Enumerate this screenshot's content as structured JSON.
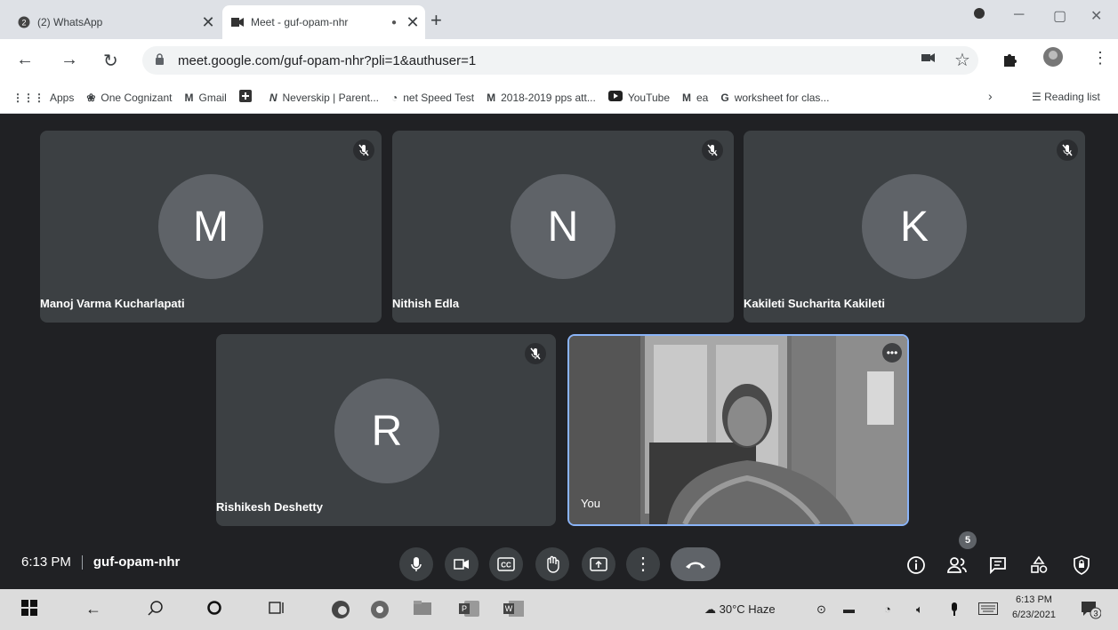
{
  "browser": {
    "tabs": [
      {
        "title": "(2) WhatsApp",
        "badge": "2"
      },
      {
        "title": "Meet - guf-opam-nhr"
      }
    ],
    "url": "meet.google.com/guf-opam-nhr?pli=1&authuser=1",
    "bookmarks": [
      {
        "label": "Apps",
        "icon": "apps-grid-icon"
      },
      {
        "label": "One Cognizant",
        "icon": "cognizant-icon"
      },
      {
        "label": "Gmail",
        "icon": "gmail-icon"
      },
      {
        "label": "",
        "icon": "plus-box-icon"
      },
      {
        "label": "Neverskip | Parent...",
        "icon": "neverskip-icon"
      },
      {
        "label": "net Speed Test",
        "icon": "gauge-icon"
      },
      {
        "label": "2018-2019 pps att...",
        "icon": "gmail-icon"
      },
      {
        "label": "YouTube",
        "icon": "youtube-icon"
      },
      {
        "label": "ea",
        "icon": "gmail-icon"
      },
      {
        "label": "worksheet for clas...",
        "icon": "google-icon"
      }
    ],
    "reading_list": "Reading list"
  },
  "meet": {
    "participants": [
      {
        "initial": "M",
        "name": "Manoj Varma Kucharlapati",
        "muted": true
      },
      {
        "initial": "N",
        "name": "Nithish Edla",
        "muted": true
      },
      {
        "initial": "K",
        "name": "Kakileti Sucharita Kakileti",
        "muted": true
      },
      {
        "initial": "R",
        "name": "Rishikesh Deshetty",
        "muted": true
      }
    ],
    "self": {
      "name": "You"
    },
    "time": "6:13 PM",
    "meeting_code": "guf-opam-nhr",
    "people_count": "5"
  },
  "taskbar": {
    "weather": "30°C Haze",
    "time": "6:13 PM",
    "date": "6/23/2021",
    "notifications": "3"
  },
  "colors": {
    "meet_bg": "#202124",
    "tile_bg": "#3c4043",
    "avatar_bg": "#5f6368",
    "active_border": "#8ab4f8"
  }
}
